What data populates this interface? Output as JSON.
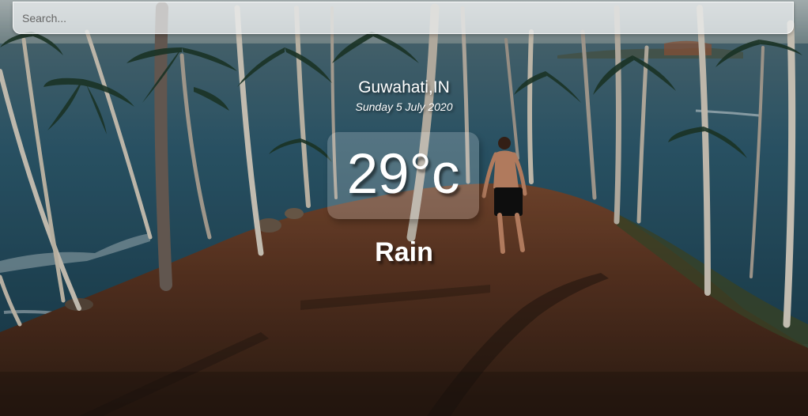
{
  "search": {
    "placeholder": "Search..."
  },
  "weather": {
    "location": "Guwahati,IN",
    "date": "Sunday 5 July 2020",
    "temperature": "29°c",
    "condition": "Rain"
  },
  "colors": {
    "sea": "#2f5a6d",
    "ground": "#5a3a27",
    "text": "#ffffff"
  }
}
